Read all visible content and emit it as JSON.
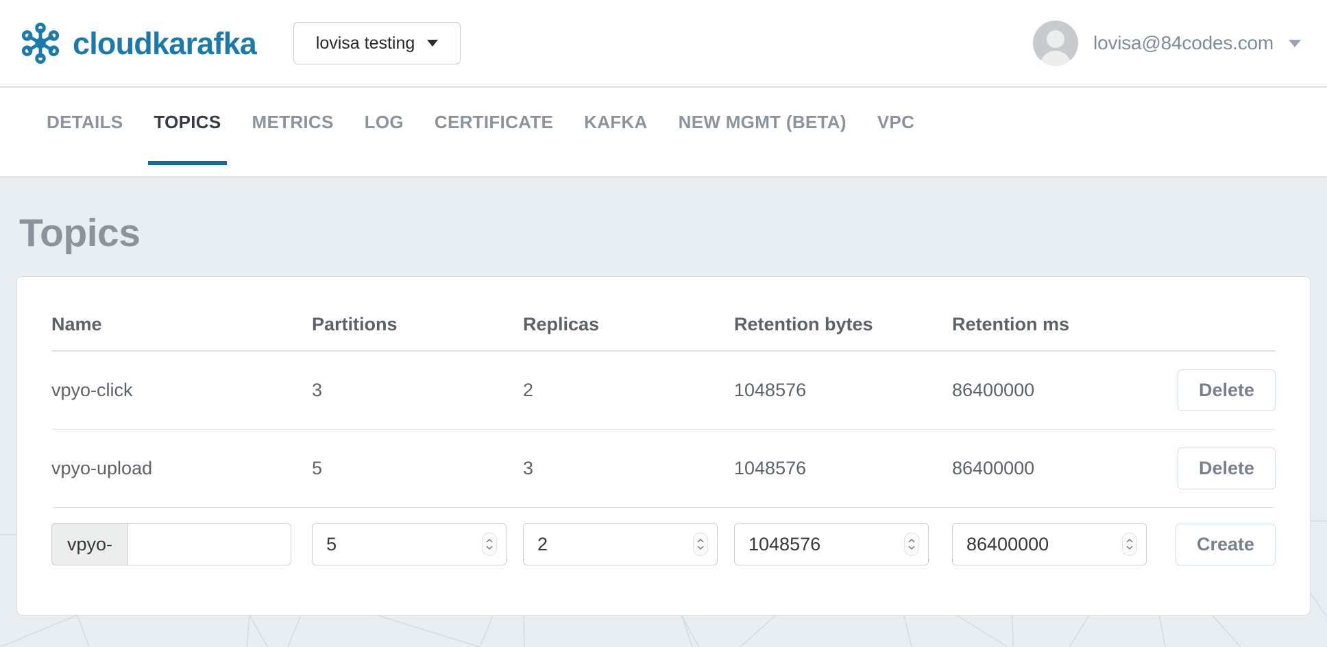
{
  "header": {
    "brand_name": "cloudkarafka",
    "brand_logo_icon": "karafka-node-cluster-logo",
    "org_switcher": {
      "label": "lovisa testing",
      "caret_icon": "caret-down-icon"
    },
    "user": {
      "email": "lovisa@84codes.com",
      "avatar_icon": "user-avatar-placeholder-icon",
      "caret_icon": "caret-down-icon"
    }
  },
  "tabs": [
    {
      "label": "DETAILS",
      "active": false
    },
    {
      "label": "TOPICS",
      "active": true
    },
    {
      "label": "METRICS",
      "active": false
    },
    {
      "label": "LOG",
      "active": false
    },
    {
      "label": "CERTIFICATE",
      "active": false
    },
    {
      "label": "KAFKA",
      "active": false
    },
    {
      "label": "NEW MGMT (BETA)",
      "active": false
    },
    {
      "label": "VPC",
      "active": false
    }
  ],
  "main": {
    "page_title": "Topics",
    "table": {
      "columns": [
        "Name",
        "Partitions",
        "Replicas",
        "Retention bytes",
        "Retention ms"
      ],
      "rows": [
        {
          "name": "vpyo-click",
          "partitions": "3",
          "replicas": "2",
          "retention_bytes": "1048576",
          "retention_ms": "86400000",
          "action_label": "Delete"
        },
        {
          "name": "vpyo-upload",
          "partitions": "5",
          "replicas": "3",
          "retention_bytes": "1048576",
          "retention_ms": "86400000",
          "action_label": "Delete"
        }
      ],
      "create_row": {
        "name_prefix": "vpyo-",
        "name_value": "",
        "name_placeholder": "",
        "partitions_value": "5",
        "replicas_value": "2",
        "retention_bytes_value": "1048576",
        "retention_ms_value": "86400000",
        "submit_label": "Create",
        "stepper_icon": "number-stepper-icon"
      }
    }
  },
  "colors": {
    "brand_blue": "#1a7aac",
    "active_tab_underline": "#166a97",
    "page_background": "#e8eef1",
    "card_background": "#ffffff",
    "muted_text": "#8b939c",
    "body_text": "#5c6268"
  }
}
